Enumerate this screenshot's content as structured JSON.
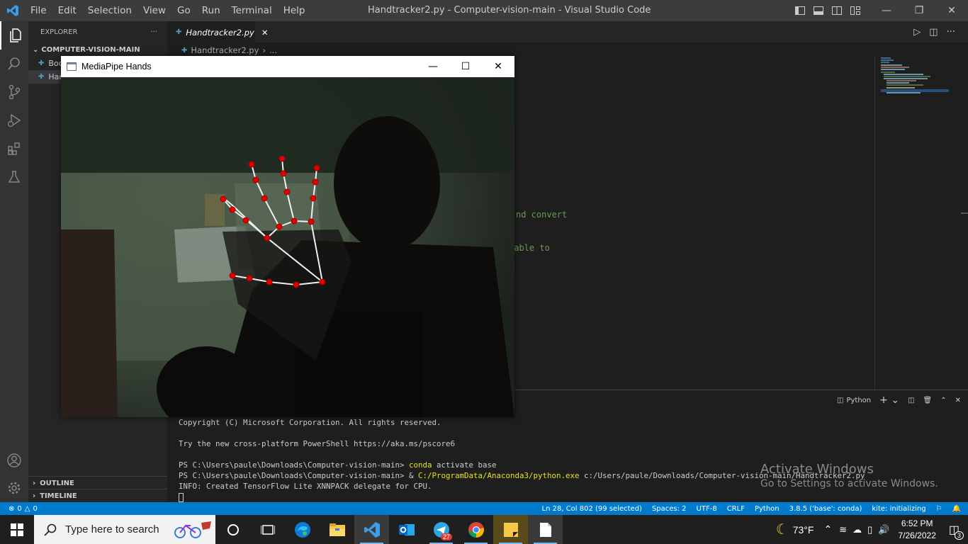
{
  "menu": [
    "File",
    "Edit",
    "Selection",
    "View",
    "Go",
    "Run",
    "Terminal",
    "Help"
  ],
  "window_title": "Handtracker2.py - Computer-vision-main - Visual Studio Code",
  "explorer": {
    "title": "EXPLORER",
    "more": "···",
    "section": "COMPUTER-VISION-MAIN",
    "files": [
      "Boc",
      "Har"
    ],
    "outline": "OUTLINE",
    "timeline": "TIMELINE"
  },
  "editor": {
    "tab": "Handtracker2.py",
    "breadcrumb": "Handtracker2.py",
    "breadcrumb_more": "...",
    "code_fragment_1": "nd convert",
    "code_fragment_2": "eable to"
  },
  "panel": {
    "shell": "Python",
    "lines": [
      "Copyright (C) Microsoft Corporation. All rights reserved.",
      "",
      "Try the new cross-platform PowerShell https://aka.ms/pscore6",
      ""
    ],
    "prompt1": "PS C:\\Users\\paule\\Downloads\\Computer-vision-main> ",
    "cmd1": "conda",
    "cmd1_rest": " activate base",
    "prompt2": "PS C:\\Users\\paule\\Downloads\\Computer-vision-main> & ",
    "cmd2": "C:/ProgramData/Anaconda3/python.exe",
    "cmd2_rest": " c:/Users/paule/Downloads/Computer-vision-main/Handtracker2.py",
    "info": "INFO: Created TensorFlow Lite XNNPACK delegate for CPU."
  },
  "watermark": {
    "line1": "Activate Windows",
    "line2": "Go to Settings to activate Windows."
  },
  "status": {
    "errors": "0",
    "warnings": "0",
    "position": "Ln 28, Col 802 (99 selected)",
    "spaces": "Spaces: 2",
    "encoding": "UTF-8",
    "eol": "CRLF",
    "language": "Python",
    "interpreter": "3.8.5 ('base': conda)",
    "kite": "kite: initializing"
  },
  "mediapipe": {
    "title": "MediaPipe Hands"
  },
  "taskbar": {
    "search_placeholder": "Type here to search",
    "telegram_badge": "27",
    "weather": "73°F",
    "time": "6:52 PM",
    "date": "7/26/2022",
    "notifications": "3"
  },
  "colors": {
    "accent": "#007acc",
    "landmark": "#e00000",
    "connection": "#ffffff"
  }
}
